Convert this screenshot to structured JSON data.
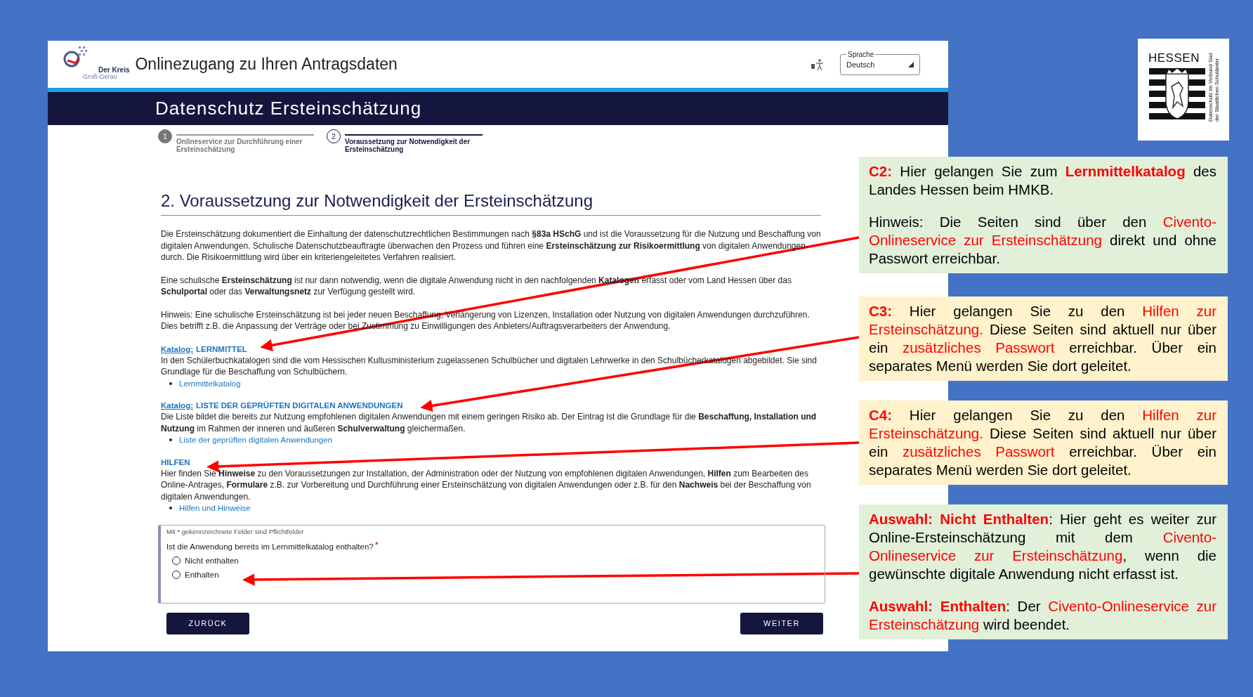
{
  "header": {
    "logo_line1": "Der Kreis",
    "logo_line2": "Groß-Gerau",
    "title": "Onlinezugang zu Ihren Antragsdaten",
    "language": {
      "label": "Sprache",
      "value": "Deutsch"
    }
  },
  "banner": {
    "title": "Datenschutz Ersteinschätzung"
  },
  "steps": [
    {
      "number": "1",
      "label": "Onlineservice zur Durchführung einer Ersteinschätzung",
      "selected": false
    },
    {
      "number": "2",
      "label": "Voraussetzung zur Notwendigkeit der Ersteinschätzung",
      "selected": true
    }
  ],
  "heading": "2. Voraussetzung zur Notwendigkeit der Ersteinschätzung",
  "intro": [
    "Die Ersteinschätzung dokumentiert die Einhaltung der datenschutzrechtlichen Bestimmungen nach **§83a HSchG** und ist die Voraussetzung für die Nutzung und Beschaffung von digitalen Anwendungen. Schulische Datenschutzbeauftragte überwachen den Prozess und führen eine **Ersteinschätzung zur Risikoermittlung** von digitalen Anwendungen durch. Die Risikoermittlung wird über ein kriteriengeleitetes Verfahren realisiert.",
    "Eine schulische **Ersteinschätzung** ist nur dann notwendig, wenn die digitale Anwendung nicht in den nachfolgenden **Katalogen** erfasst oder vom Land Hessen über das **Schulportal** oder das **Verwaltungsnetz** zur Verfügung gestellt wird.",
    "Hinweis: Eine schulische Ersteinschätzung ist bei jeder neuen Beschaffung, Verlängerung von Lizenzen, Installation oder Nutzung von digitalen Anwendungen durchzuführen. Dies betrifft z.B. die Anpassung der Verträge oder bei Zustimmung zu Einwilligungen des Anbieters/Auftragsverarbeiters der Anwendung."
  ],
  "sections": [
    {
      "prefix": "Katalog:",
      "title": "LERNMITTEL",
      "text": "In den Schülerbuchkatalogen sind die vom Hessischen Kultusministerium zugelassenen Schulbücher und digitalen Lehrwerke in den Schulbücherkatalogen abgebildet. Sie sind Grundlage für die Beschaffung von Schulbüchern.",
      "link": "Lernmittelkatalog"
    },
    {
      "prefix": "Katalog:",
      "title": "LISTE DER GEPRÜFTEN DIGITALEN ANWENDUNGEN",
      "text": "Die Liste bildet die bereits zur Nutzung empfohlenen digitalen Anwendungen mit einem geringen Risiko ab. Der Eintrag ist die Grundlage für die **Beschaffung, Installation und Nutzung** im Rahmen der inneren und äußeren **Schulverwaltung** gleichermaßen.",
      "link": "Liste der geprüften digitalen Anwendungen"
    },
    {
      "title": "HILFEN",
      "text": "Hier finden Sie **Hinweise** zu den Voraussetzungen zur Installation, der Administration oder der Nutzung von empfohlenen digitalen Anwendungen, **Hilfen** zum Bearbeiten des Online-Antrages, **Formulare** z.B. zur Vorbereitung und Durchführung einer Ersteinschätzung von digitalen Anwendungen oder z.B. für den **Nachweis** bei der Beschaffung von digitalen Anwendungen.",
      "link": "Hilfen und Hinweise"
    }
  ],
  "form": {
    "note": "Mit * gekennzeichnete Felder sind Pflichtfelder",
    "question": "Ist die Anwendung bereits im Lernmittelkatalog enthalten?",
    "required_mark": "*",
    "options": [
      {
        "label": "Nicht enthalten",
        "checked": false
      },
      {
        "label": "Enthalten",
        "checked": false
      }
    ]
  },
  "buttons": {
    "back": "ZURÜCK",
    "next": "WEITER"
  },
  "hessen_logo": {
    "title": "HESSEN",
    "line1": "Datenschutz im Verbund Süd",
    "line2": "der Staatlichen Schulämter"
  },
  "annotations": [
    {
      "color": "#e2efd9",
      "paragraphs": [
        [
          {
            "kind": "label",
            "text": "C2:"
          },
          {
            "kind": "plain",
            "text": " Hier gelangen Sie zum "
          },
          {
            "kind": "strong",
            "text": "Lernmittelkatalog"
          },
          {
            "kind": "plain",
            "text": " des Landes Hessen beim HMKB."
          }
        ],
        [
          {
            "kind": "plain",
            "text": "Hinweis:  Die Seiten sind über den "
          },
          {
            "kind": "highlight",
            "text": "Civento-Onlineservice zur Ersteinschätzung"
          },
          {
            "kind": "plain",
            "text": " direkt und ohne Passwort erreichbar."
          }
        ]
      ]
    },
    {
      "color": "#fff2cc",
      "paragraphs": [
        [
          {
            "kind": "label",
            "text": "C3:"
          },
          {
            "kind": "plain",
            "text": " Hier gelangen Sie zu den "
          },
          {
            "kind": "highlight",
            "text": "Hilfen zur Ersteinschätzung."
          },
          {
            "kind": "plain",
            "text": " Diese Seiten sind aktuell nur über ein "
          },
          {
            "kind": "highlight",
            "text": "zusätzliches Passwort"
          },
          {
            "kind": "plain",
            "text": " erreichbar. Über ein separates Menü werden Sie dort geleitet."
          }
        ]
      ]
    },
    {
      "color": "#fff2cc",
      "paragraphs": [
        [
          {
            "kind": "label",
            "text": "C4:"
          },
          {
            "kind": "plain",
            "text": " Hier gelangen Sie zu den "
          },
          {
            "kind": "highlight",
            "text": "Hilfen zur Ersteinschätzung."
          },
          {
            "kind": "plain",
            "text": " Diese Seiten sind aktuell nur über ein "
          },
          {
            "kind": "highlight",
            "text": "zusätzliches Passwort"
          },
          {
            "kind": "plain",
            "text": " erreichbar. Über ein separates Menü werden Sie dort geleitet."
          }
        ]
      ]
    },
    {
      "color": "#e2efd9",
      "paragraphs": [
        [
          {
            "kind": "label",
            "text": "Auswahl: Nicht Enthalten"
          },
          {
            "kind": "plain",
            "text": ": Hier geht es weiter zur Online-Ersteinschätzung mit dem "
          },
          {
            "kind": "highlight",
            "text": "Civento-Onlineservice zur Ersteinschätzung"
          },
          {
            "kind": "plain",
            "text": ", wenn die gewünschte digitale Anwendung nicht erfasst ist."
          }
        ],
        [
          {
            "kind": "label",
            "text": "Auswahl: Enthalten"
          },
          {
            "kind": "plain",
            "text": ": Der "
          },
          {
            "kind": "highlight",
            "text": "Civento-Onlineservice zur Ersteinschätzung"
          },
          {
            "kind": "plain",
            "text": " wird beendet."
          }
        ]
      ]
    }
  ]
}
